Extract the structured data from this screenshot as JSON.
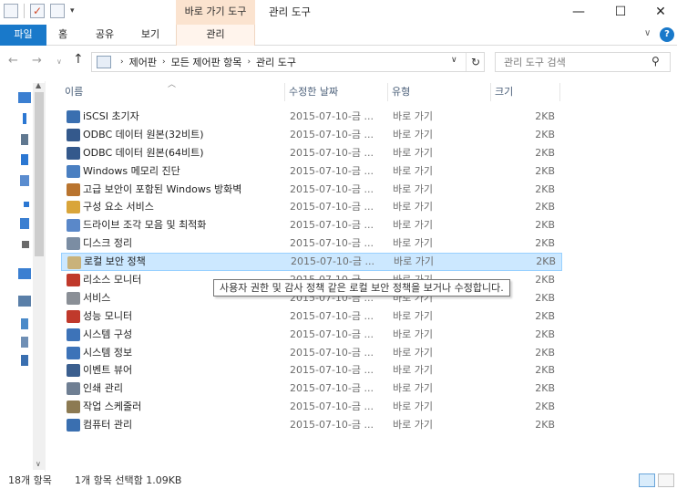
{
  "window": {
    "context_tab_label": "바로 가기 도구",
    "title": "관리 도구",
    "controls": {
      "minimize": "—",
      "maximize": "☐",
      "close": "✕"
    }
  },
  "ribbon": {
    "tabs": {
      "file": "파일",
      "home": "홈",
      "share": "공유",
      "view": "보기",
      "manage": "관리"
    },
    "expand_glyph": "∨",
    "help_glyph": "?"
  },
  "address": {
    "breadcrumb": [
      "제어판",
      "모든 제어판 항목",
      "관리 도구"
    ],
    "separator": "›",
    "search_placeholder": "관리 도구 검색"
  },
  "columns": {
    "name": "이름",
    "date": "수정한 날짜",
    "type": "유형",
    "size": "크기"
  },
  "files": [
    {
      "name": "iSCSI 초기자",
      "date": "2015-07-10-금 ...",
      "type": "바로 가기",
      "size": "2KB",
      "icon": "iscsi-icon",
      "color": "#3a6fb0",
      "selected": false
    },
    {
      "name": "ODBC 데이터 원본(32비트)",
      "date": "2015-07-10-금 ...",
      "type": "바로 가기",
      "size": "2KB",
      "icon": "odbc-icon",
      "color": "#34598c",
      "selected": false
    },
    {
      "name": "ODBC 데이터 원본(64비트)",
      "date": "2015-07-10-금 ...",
      "type": "바로 가기",
      "size": "2KB",
      "icon": "odbc-icon",
      "color": "#34598c",
      "selected": false
    },
    {
      "name": "Windows 메모리 진단",
      "date": "2015-07-10-금 ...",
      "type": "바로 가기",
      "size": "2KB",
      "icon": "memory-diagnostic-icon",
      "color": "#4a7fc1",
      "selected": false
    },
    {
      "name": "고급 보안이 포함된 Windows 방화벽",
      "date": "2015-07-10-금 ...",
      "type": "바로 가기",
      "size": "2KB",
      "icon": "firewall-icon",
      "color": "#b9742f",
      "selected": false
    },
    {
      "name": "구성 요소 서비스",
      "date": "2015-07-10-금 ...",
      "type": "바로 가기",
      "size": "2KB",
      "icon": "component-services-icon",
      "color": "#d9a53a",
      "selected": false
    },
    {
      "name": "드라이브 조각 모음 및 최적화",
      "date": "2015-07-10-금 ...",
      "type": "바로 가기",
      "size": "2KB",
      "icon": "defrag-icon",
      "color": "#5a88c9",
      "selected": false
    },
    {
      "name": "디스크 정리",
      "date": "2015-07-10-금 ...",
      "type": "바로 가기",
      "size": "2KB",
      "icon": "disk-cleanup-icon",
      "color": "#7b8da3",
      "selected": false
    },
    {
      "name": "로컬 보안 정책",
      "date": "2015-07-10-금 ...",
      "type": "바로 가기",
      "size": "2KB",
      "icon": "local-security-policy-icon",
      "color": "#c9b27a",
      "selected": true
    },
    {
      "name": "리소스 모니터",
      "date": "2015-07-10-금 ...",
      "type": "바로 가기",
      "size": "2KB",
      "icon": "resource-monitor-icon",
      "color": "#c0392b",
      "selected": false
    },
    {
      "name": "서비스",
      "date": "2015-07-10-금 ...",
      "type": "바로 가기",
      "size": "2KB",
      "icon": "services-icon",
      "color": "#8a8f96",
      "selected": false
    },
    {
      "name": "성능 모니터",
      "date": "2015-07-10-금 ...",
      "type": "바로 가기",
      "size": "2KB",
      "icon": "performance-monitor-icon",
      "color": "#c0392b",
      "selected": false
    },
    {
      "name": "시스템 구성",
      "date": "2015-07-10-금 ...",
      "type": "바로 가기",
      "size": "2KB",
      "icon": "system-configuration-icon",
      "color": "#3d73b8",
      "selected": false
    },
    {
      "name": "시스템 정보",
      "date": "2015-07-10-금 ...",
      "type": "바로 가기",
      "size": "2KB",
      "icon": "system-information-icon",
      "color": "#3d73b8",
      "selected": false
    },
    {
      "name": "이벤트 뷰어",
      "date": "2015-07-10-금 ...",
      "type": "바로 가기",
      "size": "2KB",
      "icon": "event-viewer-icon",
      "color": "#3b5f8f",
      "selected": false
    },
    {
      "name": "인쇄 관리",
      "date": "2015-07-10-금 ...",
      "type": "바로 가기",
      "size": "2KB",
      "icon": "print-management-icon",
      "color": "#6f7f93",
      "selected": false
    },
    {
      "name": "작업 스케줄러",
      "date": "2015-07-10-금 ...",
      "type": "바로 가기",
      "size": "2KB",
      "icon": "task-scheduler-icon",
      "color": "#8c7a52",
      "selected": false
    },
    {
      "name": "컴퓨터 관리",
      "date": "2015-07-10-금 ...",
      "type": "바로 가기",
      "size": "2KB",
      "icon": "computer-management-icon",
      "color": "#3a6fb0",
      "selected": false
    }
  ],
  "tooltip": "사용자 권한 및 감사 정책 같은 로컬 보안 정책을 보거나 수정합니다.",
  "status": {
    "item_count": "18개 항목",
    "selection": "1개 항목 선택함 1.09KB"
  },
  "colors": {
    "accent": "#1979ca",
    "selection_bg": "#cce8ff",
    "selection_border": "#99d1ff",
    "context_tab": "#fbe3cf"
  }
}
